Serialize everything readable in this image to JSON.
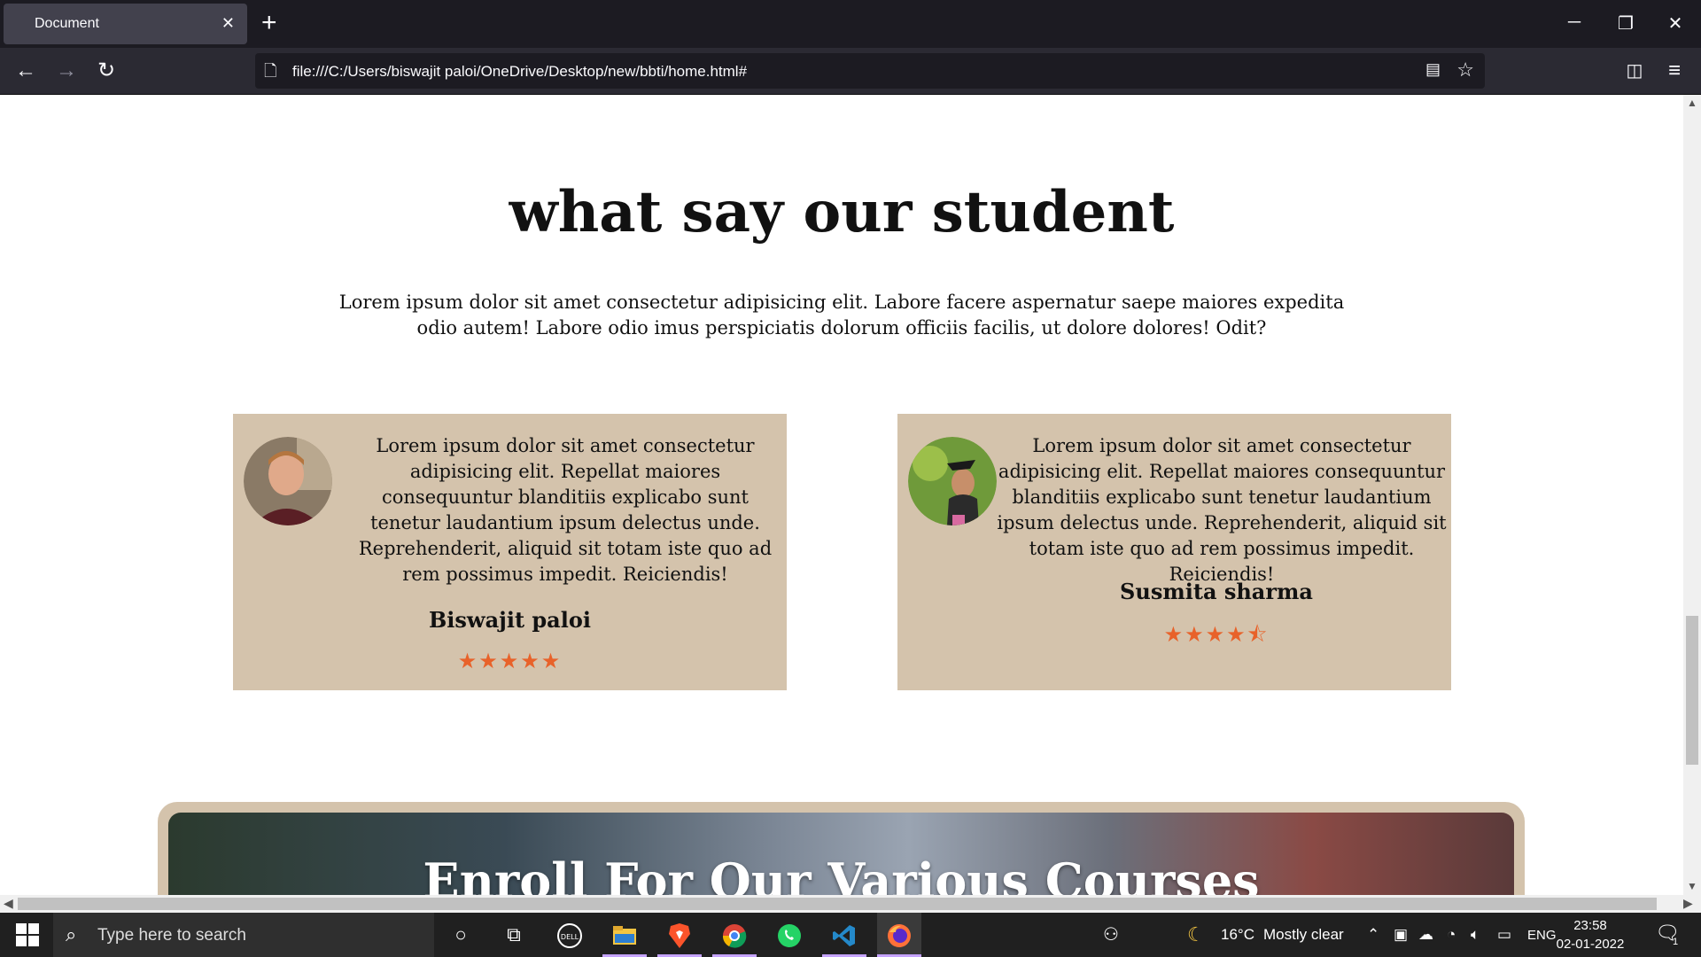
{
  "browser": {
    "tab_title": "Document",
    "tab_close": "✕",
    "new_tab": "+",
    "window_minimize": "─",
    "window_restore": "❐",
    "window_close": "✕",
    "back": "←",
    "forward": "→",
    "reload": "↻",
    "url": "file:///C:/Users/biswajit paloi/OneDrive/Desktop/new/bbti/home.html#",
    "page_icon": "🗋",
    "reader_icon": "▤",
    "bookmark_icon": "☆",
    "pocket_icon": "◫",
    "menu_icon": "≡"
  },
  "testimonials": {
    "title": "what say our student",
    "description": "Lorem ipsum dolor sit amet consectetur adipisicing elit. Labore facere aspernatur saepe maiores expedita odio autem! Labore odio imus perspiciatis dolorum officiis facilis, ut dolore dolores! Odit?",
    "cards": [
      {
        "quote": "Lorem ipsum dolor sit amet consectetur adipisicing elit. Repellat maiores consequuntur blanditiis explicabo sunt tenetur laudantium ipsum delectus unde. Reprehenderit, aliquid sit totam iste quo ad rem possimus impedit. Reiciendis!",
        "name": "Biswajit paloi",
        "rating": 5,
        "stars": "★★★★★"
      },
      {
        "quote": "Lorem ipsum dolor sit amet consectetur adipisicing elit. Repellat maiores consequuntur blanditiis explicabo sunt tenetur laudantium ipsum delectus unde. Reprehenderit, aliquid sit totam iste quo ad rem possimus impedit. Reiciendis!",
        "name": "Susmita sharma",
        "rating": 4.5,
        "stars": "★★★★⯪"
      }
    ]
  },
  "enroll": {
    "title": "Enroll For Our Various Courses"
  },
  "taskbar": {
    "search_placeholder": "Type here to search",
    "search_icon": "⌕",
    "cortana_icon": "○",
    "taskview_icon": "⧉",
    "weather_icon": "☾",
    "temperature": "16°C",
    "weather": "Mostly clear",
    "language": "ENG",
    "time": "23:58",
    "date": "02-01-2022",
    "notification_count": "1",
    "apps": [
      "dell-icon",
      "file-explorer-icon",
      "brave-icon",
      "chrome-icon",
      "whatsapp-icon",
      "vscode-icon",
      "firefox-icon"
    ]
  },
  "colors": {
    "card_bg": "#d4c3ac",
    "star": "#e8622a",
    "chrome_dark": "#1c1b22"
  }
}
